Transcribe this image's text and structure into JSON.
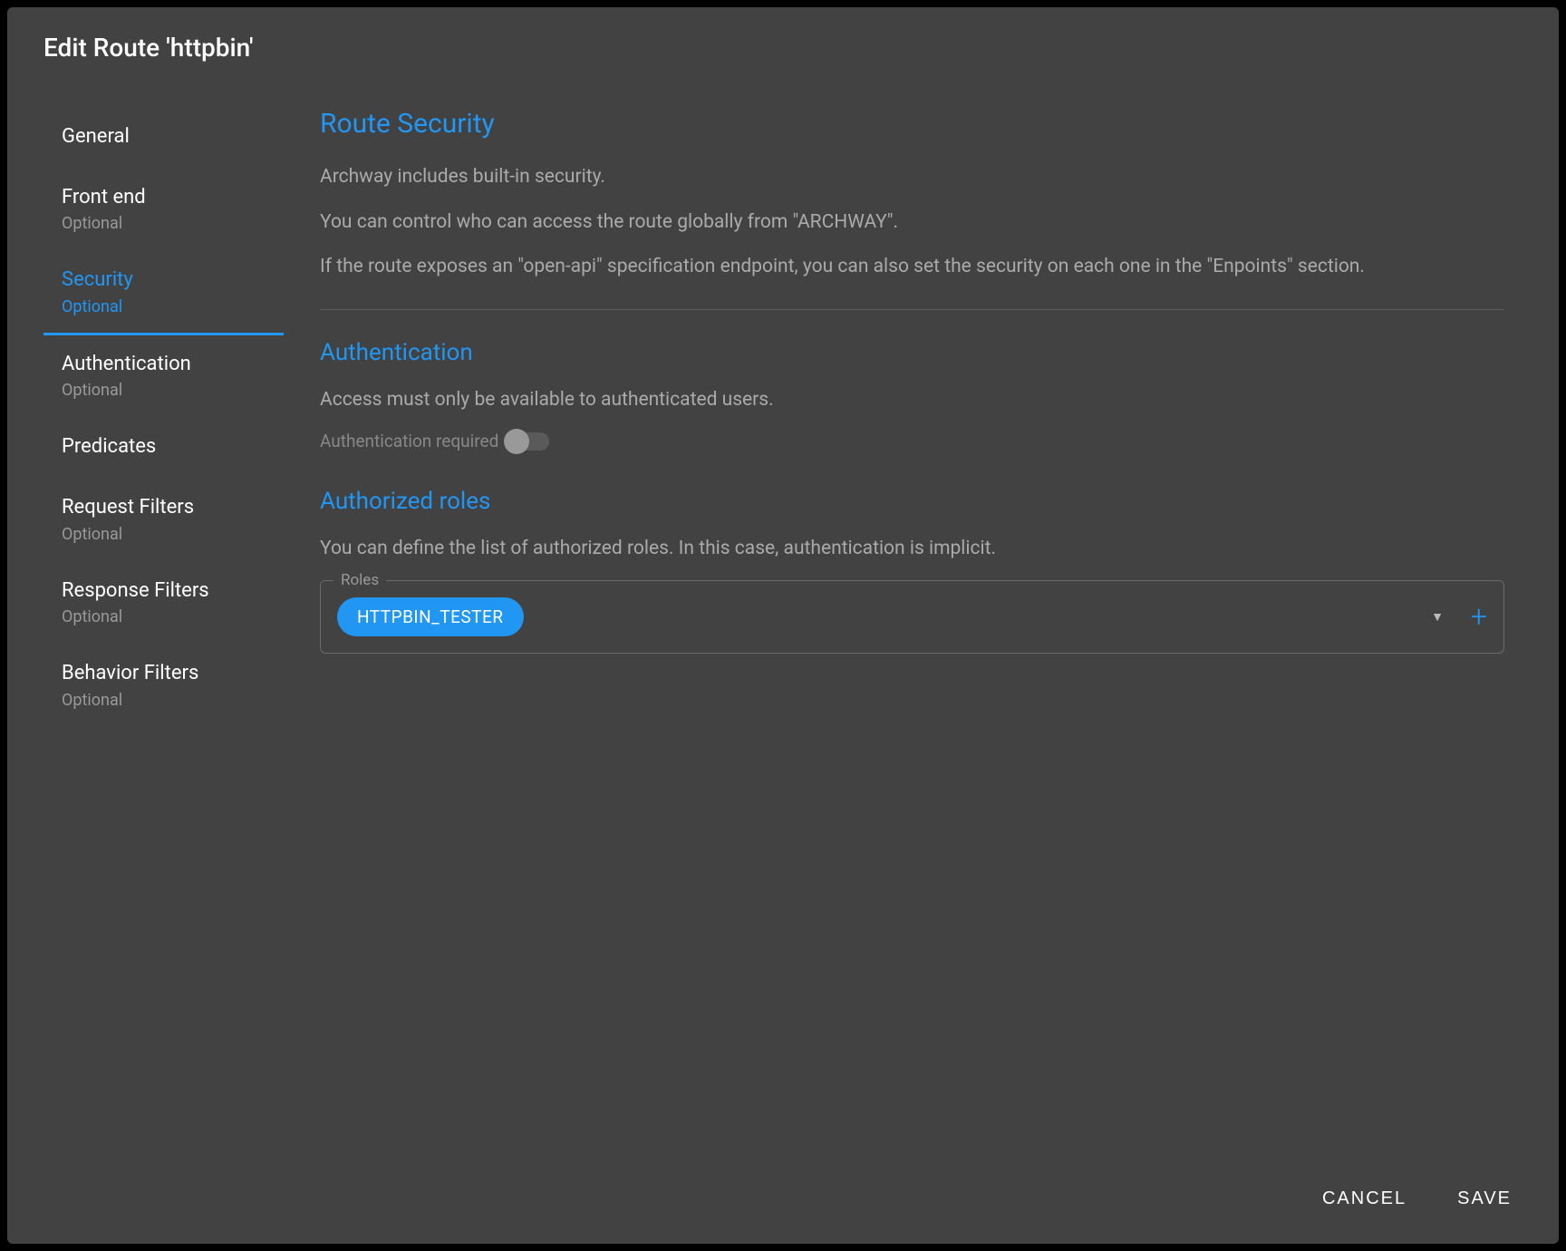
{
  "dialog": {
    "title": "Edit Route 'httpbin'"
  },
  "sidebar": {
    "items": [
      {
        "label": "General",
        "sub": null,
        "active": false
      },
      {
        "label": "Front end",
        "sub": "Optional",
        "active": false
      },
      {
        "label": "Security",
        "sub": "Optional",
        "active": true
      },
      {
        "label": "Authentication",
        "sub": "Optional",
        "active": false
      },
      {
        "label": "Predicates",
        "sub": null,
        "active": false
      },
      {
        "label": "Request Filters",
        "sub": "Optional",
        "active": false
      },
      {
        "label": "Response Filters",
        "sub": "Optional",
        "active": false
      },
      {
        "label": "Behavior Filters",
        "sub": "Optional",
        "active": false
      }
    ]
  },
  "content": {
    "route_security_title": "Route Security",
    "desc1": "Archway includes built-in security.",
    "desc2": "You can control who can access the route globally from \"ARCHWAY\".",
    "desc3": "If the route exposes an \"open-api\" specification endpoint, you can also set the security on each one in the \"Enpoints\" section.",
    "auth_title": "Authentication",
    "auth_desc": "Access must only be available to authenticated users.",
    "auth_toggle_label": "Authentication required",
    "auth_toggle_value": false,
    "roles_title": "Authorized roles",
    "roles_desc": "You can define the list of authorized roles. In this case, authentication is implicit.",
    "roles_legend": "Roles",
    "roles_chips": [
      "HTTPBIN_TESTER"
    ]
  },
  "footer": {
    "cancel": "CANCEL",
    "save": "SAVE"
  }
}
